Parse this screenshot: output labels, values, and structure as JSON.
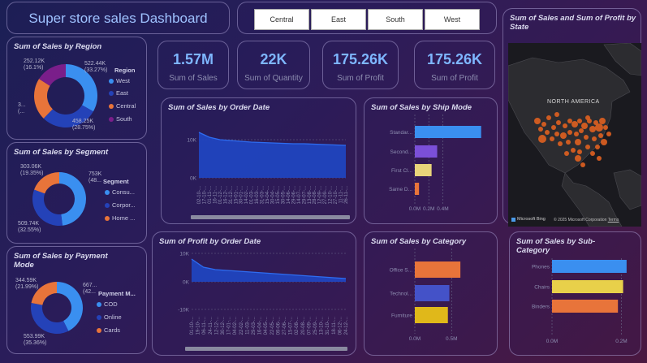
{
  "header": {
    "title": "Super store sales Dashboard"
  },
  "slicer": {
    "options": [
      "Central",
      "East",
      "South",
      "West"
    ]
  },
  "kpis": [
    {
      "value": "1.57M",
      "label": "Sum of Sales"
    },
    {
      "value": "22K",
      "label": "Sum of Quantity"
    },
    {
      "value": "175.26K",
      "label": "Sum of Profit"
    },
    {
      "value": "175.26K",
      "label": "Sum of Profit"
    }
  ],
  "region": {
    "title": "Sum of Sales by Region",
    "legend_title": "Region",
    "labels": {
      "top": "252.12K",
      "top_pct": "(16.1%)",
      "right": "522.44K",
      "right_pct": "(33.27%)",
      "bottom": "458.25K",
      "bottom_pct": "(28.75%)",
      "left": "3...",
      "left_pct": "(..."
    },
    "items": [
      {
        "name": "West",
        "color": "#3a8ff0"
      },
      {
        "name": "East",
        "color": "#2442b8"
      },
      {
        "name": "Central",
        "color": "#e8743a"
      },
      {
        "name": "South",
        "color": "#7a1e8a"
      }
    ],
    "values": [
      522.44,
      458.25,
      340,
      252.12
    ]
  },
  "segment": {
    "title": "Sum of Sales by Segment",
    "legend_title": "Segment",
    "labels": {
      "top": "303.06K",
      "top_pct": "(19.35%)",
      "right": "753K",
      "right_pct": "(48...",
      "bottom": "509.74K",
      "bottom_pct": "(32.55%)"
    },
    "items": [
      {
        "name": "Consu...",
        "color": "#3a8ff0"
      },
      {
        "name": "Corpor...",
        "color": "#2442b8"
      },
      {
        "name": "Home ...",
        "color": "#e8743a"
      }
    ],
    "values": [
      753,
      509.74,
      303.06
    ]
  },
  "payment": {
    "title": "Sum of Sales by Payment Mode",
    "legend_title": "Payment M...",
    "labels": {
      "top": "344.59K",
      "top_pct": "(21.99%)",
      "right": "667...",
      "right_pct": "(42...",
      "bottom": "553.99K",
      "bottom_pct": "(35.36%)"
    },
    "items": [
      {
        "name": "COD",
        "color": "#3a8ff0"
      },
      {
        "name": "Online",
        "color": "#2442b8"
      },
      {
        "name": "Cards",
        "color": "#e8743a"
      }
    ],
    "values": [
      667,
      553.99,
      344.59
    ]
  },
  "order_date_sales": {
    "title": "Sum of Sales by Order Date",
    "y_ticks": [
      "10K",
      "0K"
    ],
    "x_labels": [
      "02-10-...",
      "17-10-...",
      "01-11-...",
      "16-11-...",
      "01-12-...",
      "16-12-...",
      "31-12-...",
      "15-01-...",
      "30-01-...",
      "14-02-...",
      "01-03-...",
      "16-03-...",
      "31-03-...",
      "15-04-...",
      "30-04-...",
      "15-05-...",
      "30-05-...",
      "14-06-...",
      "29-06-...",
      "14-07-...",
      "29-07-...",
      "13-08-...",
      "28-08-...",
      "12-09-...",
      "27-09-...",
      "12-10-...",
      "27-10-...",
      "11-11-...",
      "26-11-..."
    ]
  },
  "order_date_profit": {
    "title": "Sum of Profit by Order Date",
    "y_ticks": [
      "10K",
      "0K",
      "-10K"
    ],
    "x_labels": [
      "01-10-...",
      "19-10-...",
      "06-11-...",
      "24-11-...",
      "12-12-...",
      "30-12-...",
      "17-01-...",
      "04-02-...",
      "22-02-...",
      "11-03-...",
      "29-03-...",
      "16-04-...",
      "04-05-...",
      "22-05-...",
      "09-06-...",
      "27-06-...",
      "15-07-...",
      "02-08-...",
      "20-08-...",
      "07-09-...",
      "25-09-...",
      "13-10-...",
      "31-10-...",
      "18-11-...",
      "06-12-...",
      "24-12-..."
    ]
  },
  "ship_mode": {
    "title": "Sum of Sales by Ship Mode",
    "categories": [
      "Standar...",
      "Second...",
      "First Cl...",
      "Same D..."
    ],
    "colors": [
      "#3a8ff0",
      "#7b4fd8",
      "#e8d47a",
      "#e8743a"
    ],
    "values": [
      0.95,
      0.32,
      0.24,
      0.06
    ],
    "x_ticks": [
      "0.0M",
      "0.2M",
      "0.4M"
    ]
  },
  "category": {
    "title": "Sum of Sales by Category",
    "categories": [
      "Office S...",
      "Technol...",
      "Furniture"
    ],
    "colors": [
      "#e8743a",
      "#4452c8",
      "#e0b81a"
    ],
    "values": [
      0.62,
      0.47,
      0.45
    ],
    "x_ticks": [
      "0.0M",
      "0.5M"
    ]
  },
  "subcategory": {
    "title": "Sum of Sales by Sub-Category",
    "categories": [
      "Phones",
      "Chairs",
      "Binders"
    ],
    "colors": [
      "#3a8ff0",
      "#e8d04a",
      "#e8743a"
    ],
    "values": [
      0.215,
      0.205,
      0.19
    ],
    "x_ticks": [
      "0.0M",
      "0.2M"
    ]
  },
  "map_card": {
    "title": "Sum of Sales and Sum of Profit by State",
    "region_label": "NORTH AMERICA",
    "provider": "Microsoft Bing",
    "copyright": "© 2025 Microsoft Corporation",
    "terms": "Terms"
  }
}
